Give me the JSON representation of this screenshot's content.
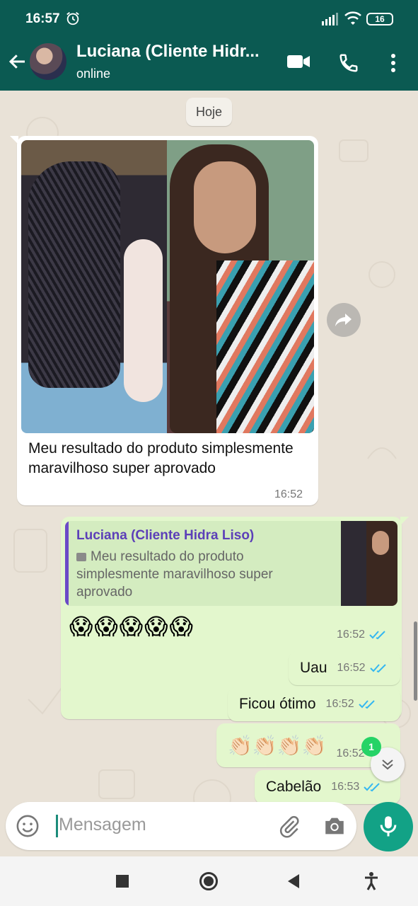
{
  "status_bar": {
    "time": "16:57",
    "battery": "16"
  },
  "header": {
    "contact_name": "Luciana (Cliente Hidr...",
    "status": "online"
  },
  "chat": {
    "date_chip": "Hoje",
    "incoming": {
      "text": "Meu resultado do produto simplesmente maravilhoso super aprovado",
      "time": "16:52"
    },
    "reply": {
      "quoted_name": "Luciana (Cliente Hidra Liso)",
      "quoted_text": "Meu resultado do produto simplesmente maravilhoso super aprovado",
      "emojis": "😱😱😱😱😱",
      "time": "16:52"
    },
    "outgoing": [
      {
        "text": "Uau",
        "time": "16:52"
      },
      {
        "text": "Ficou ótimo",
        "time": "16:52"
      },
      {
        "text": "👏🏻👏🏻👏🏻👏🏻",
        "time": "16:52"
      },
      {
        "text": "Cabelão",
        "time": "16:53"
      }
    ],
    "unread_count": "1"
  },
  "input": {
    "placeholder": "Mensagem"
  },
  "colors": {
    "header": "#0b5a52",
    "accent": "#12a286",
    "outgoing_bubble": "#e3f7cd",
    "read_ticks": "#34b7f1"
  },
  "icons": [
    "back-arrow-icon",
    "video-call-icon",
    "phone-icon",
    "more-icon",
    "forward-icon",
    "emoji-icon",
    "attach-icon",
    "camera-icon",
    "mic-icon",
    "chevron-down-icon"
  ]
}
